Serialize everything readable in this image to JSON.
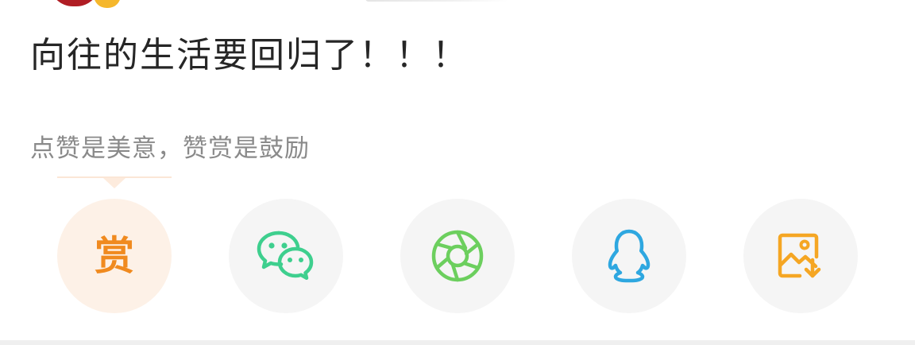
{
  "post": {
    "title": "向往的生活要回归了！！！"
  },
  "reward": {
    "prompt": "点赞是美意，赞赏是鼓励",
    "button_glyph": "赏"
  },
  "share_buttons": [
    {
      "name": "reward",
      "icon": "reward-icon",
      "color": "#f08a1f"
    },
    {
      "name": "wechat",
      "icon": "wechat-icon",
      "color": "#3ecf8e"
    },
    {
      "name": "moments",
      "icon": "moments-shutter-icon",
      "color": "#6ccf5e"
    },
    {
      "name": "qq",
      "icon": "qq-penguin-icon",
      "color": "#2ea7e0"
    },
    {
      "name": "save-image",
      "icon": "save-image-icon",
      "color": "#f5a623"
    }
  ]
}
